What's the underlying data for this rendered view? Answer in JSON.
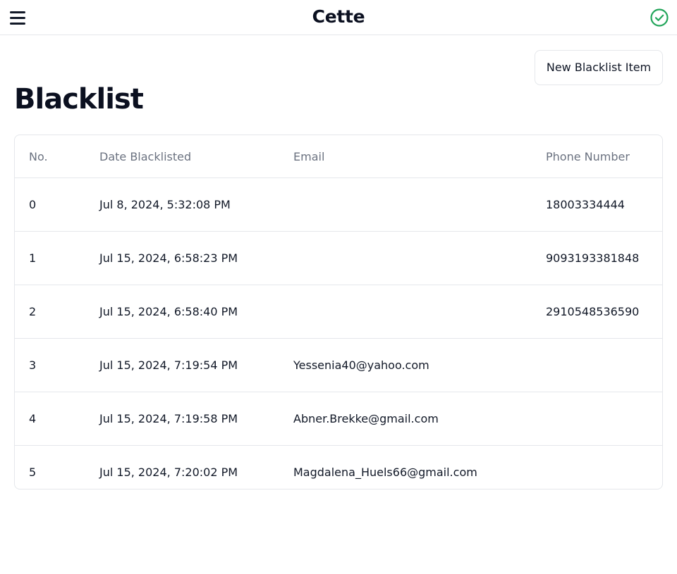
{
  "header": {
    "app_title": "Cette",
    "menu_icon": "hamburger-menu-icon",
    "status_icon": "check-circle-icon",
    "status_color": "#22a55a"
  },
  "toolbar": {
    "new_button_label": "New Blacklist Item"
  },
  "page": {
    "title": "Blacklist"
  },
  "table": {
    "headers": {
      "no": "No.",
      "date": "Date Blacklisted",
      "email": "Email",
      "phone": "Phone Number"
    },
    "rows": [
      {
        "no": "0",
        "date": "Jul 8, 2024, 5:32:08 PM",
        "email": "",
        "phone": "18003334444"
      },
      {
        "no": "1",
        "date": "Jul 15, 2024, 6:58:23 PM",
        "email": "",
        "phone": "9093193381848"
      },
      {
        "no": "2",
        "date": "Jul 15, 2024, 6:58:40 PM",
        "email": "",
        "phone": "2910548536590"
      },
      {
        "no": "3",
        "date": "Jul 15, 2024, 7:19:54 PM",
        "email": "Yessenia40@yahoo.com",
        "phone": ""
      },
      {
        "no": "4",
        "date": "Jul 15, 2024, 7:19:58 PM",
        "email": "Abner.Brekke@gmail.com",
        "phone": ""
      },
      {
        "no": "5",
        "date": "Jul 15, 2024, 7:20:02 PM",
        "email": "Magdalena_Huels66@gmail.com",
        "phone": ""
      }
    ]
  }
}
